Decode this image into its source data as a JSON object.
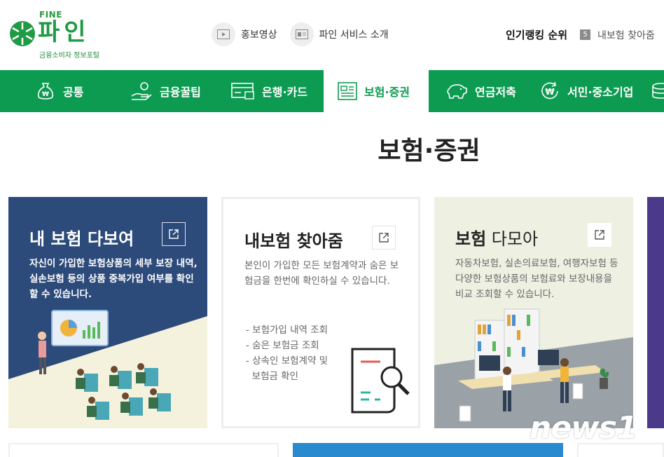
{
  "logo": {
    "fine": "FINE",
    "title": "파인",
    "subtitle": "금융소비자 정보포털"
  },
  "top_links": [
    {
      "label": "홍보영상",
      "icon": "play-video-icon"
    },
    {
      "label": "파인 서비스 소개",
      "icon": "service-card-icon"
    }
  ],
  "ranking": {
    "title": "인기랭킹 순위",
    "number": "5",
    "item": "내보험 찾아줌"
  },
  "nav": [
    {
      "label": "공통",
      "icon": "money-bag-icon"
    },
    {
      "label": "금융꿀팁",
      "icon": "hand-coin-icon"
    },
    {
      "label": "은행·카드",
      "icon": "bank-card-icon"
    },
    {
      "label": "보험·증권",
      "icon": "document-icon",
      "active": true
    },
    {
      "label": "연금저축",
      "icon": "piggy-bank-icon"
    },
    {
      "label": "서민·중소기업",
      "icon": "won-refresh-icon"
    }
  ],
  "page": {
    "title": "보험·증권"
  },
  "cards": [
    {
      "title": "내 보험 다보여",
      "desc": "자신이 가입한 보험상품의 세부 보장 내역, 실손보험 등의 상품 중복가입 여부를 확인할 수 있습니다."
    },
    {
      "title": "내보험 찾아줌",
      "desc": "본인이 가입한 모든 보험계약과 숨은 보험금을 한번에 확인하실 수 있습니다.",
      "bullets": [
        "- 보험가입 내역 조회",
        "- 숨은 보험금 조회",
        "- 상속인 보험계약 및",
        "  보험금 확인"
      ]
    },
    {
      "title_bold": "보험",
      "title_light": " 다모아",
      "desc": "자동차보험, 실손의료보험, 여행자보험 등 다양한 보험상품의 보험료와 보장내용을 비교 조회할 수 있습니다."
    }
  ],
  "watermark": "news1",
  "colors": {
    "brand_green": "#0d9b52",
    "card1_bg": "#2c4a7a",
    "card3_bg": "#eef0e2"
  }
}
